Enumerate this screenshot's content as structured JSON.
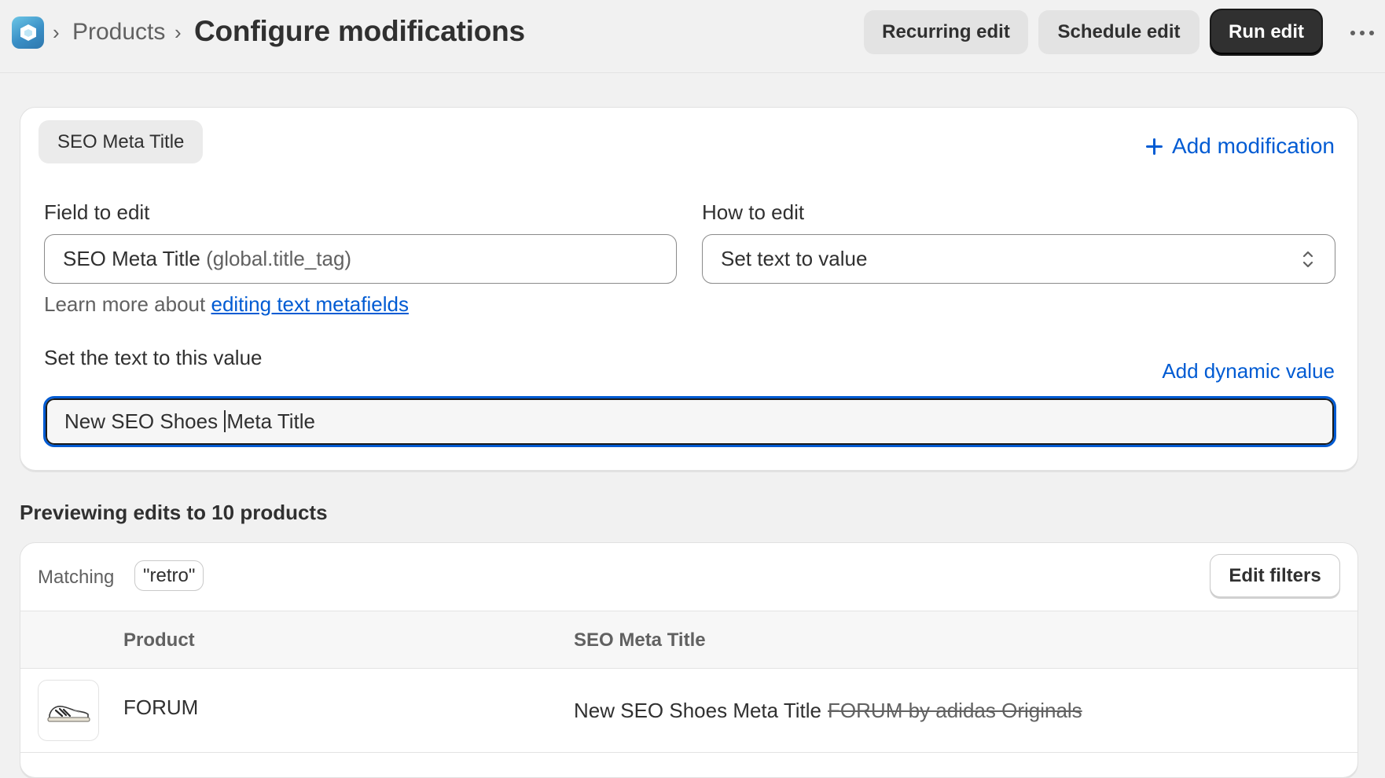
{
  "header": {
    "breadcrumb_parent": "Products",
    "title": "Configure modifications",
    "buttons": {
      "recurring": "Recurring edit",
      "schedule": "Schedule edit",
      "run": "Run edit"
    },
    "icons": {
      "logo": "app-logo-icon",
      "more": "more-horizontal-icon"
    }
  },
  "modification": {
    "tag": "SEO Meta Title",
    "add_modification": "Add modification",
    "field_to_edit": {
      "label": "Field to edit",
      "value": "SEO Meta Title",
      "key": "(global.title_tag)"
    },
    "how_to_edit": {
      "label": "How to edit",
      "selected": "Set text to value"
    },
    "learn_more": {
      "prefix": "Learn more about",
      "link": "editing text metafields"
    },
    "value_field": {
      "label": "Set the text to this value",
      "add_dynamic": "Add dynamic value",
      "value_before_caret": "New SEO Shoes ",
      "value_after_caret": "Meta Title"
    }
  },
  "preview": {
    "heading": "Previewing edits to 10 products",
    "matching_label": "Matching",
    "filter": "\"retro\"",
    "edit_filters": "Edit filters",
    "columns": {
      "product": "Product",
      "field": "SEO Meta Title"
    },
    "rows": [
      {
        "product": "FORUM",
        "new_value": "New SEO Shoes Meta Title",
        "old_value": "FORUM by adidas Originals",
        "thumbnail": "sneaker-thumbnail"
      }
    ]
  },
  "colors": {
    "accent": "#005bd3",
    "background": "#f1f1f1",
    "primary_button": "#303030"
  }
}
